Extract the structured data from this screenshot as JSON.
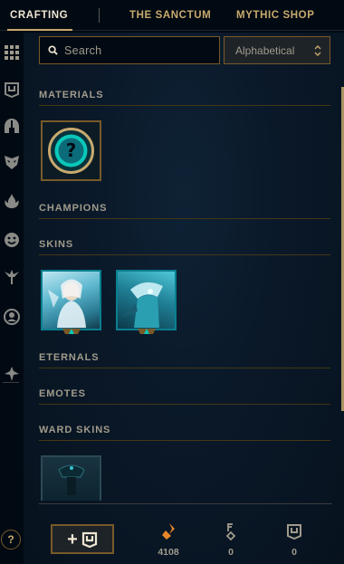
{
  "tabs": [
    {
      "label": "CRAFTING",
      "active": true
    },
    {
      "label": "THE SANCTUM",
      "active": false
    },
    {
      "label": "MYTHIC SHOP",
      "active": false
    }
  ],
  "search": {
    "placeholder": "Search",
    "value": ""
  },
  "sort": {
    "selected": "Alphabetical"
  },
  "nav_icons": [
    "grid-icon",
    "ward-chest-icon",
    "helmet-icon",
    "mask-icon",
    "flame-icon",
    "emote-icon",
    "ward-icon",
    "profile-icon",
    "wings-icon"
  ],
  "sections": {
    "materials": "MATERIALS",
    "champions": "CHAMPIONS",
    "skins": "SKINS",
    "eternals": "ETERNALS",
    "emotes": "EMOTES",
    "ward_skins": "WARD SKINS"
  },
  "items": {
    "materials": [
      {
        "icon": "mystery-question-icon"
      }
    ],
    "skins": [
      {
        "icon": "skin-portrait"
      },
      {
        "icon": "skin-portrait"
      }
    ],
    "ward_skins": [
      {
        "icon": "ward-skin-portrait"
      }
    ]
  },
  "bottom": {
    "help_label": "?",
    "craft_label": "+",
    "currencies": [
      {
        "name": "orange-essence-icon",
        "amount": "4108",
        "color": "#e8862a"
      },
      {
        "name": "key-icon",
        "amount": "0",
        "color": "#a09b8c"
      },
      {
        "name": "chest-icon",
        "amount": "0",
        "color": "#a09b8c"
      }
    ]
  },
  "colors": {
    "gold": "#c8aa6e",
    "gold_dark": "#785a28",
    "teal": "#0ac8b9",
    "background": "#010a13"
  }
}
